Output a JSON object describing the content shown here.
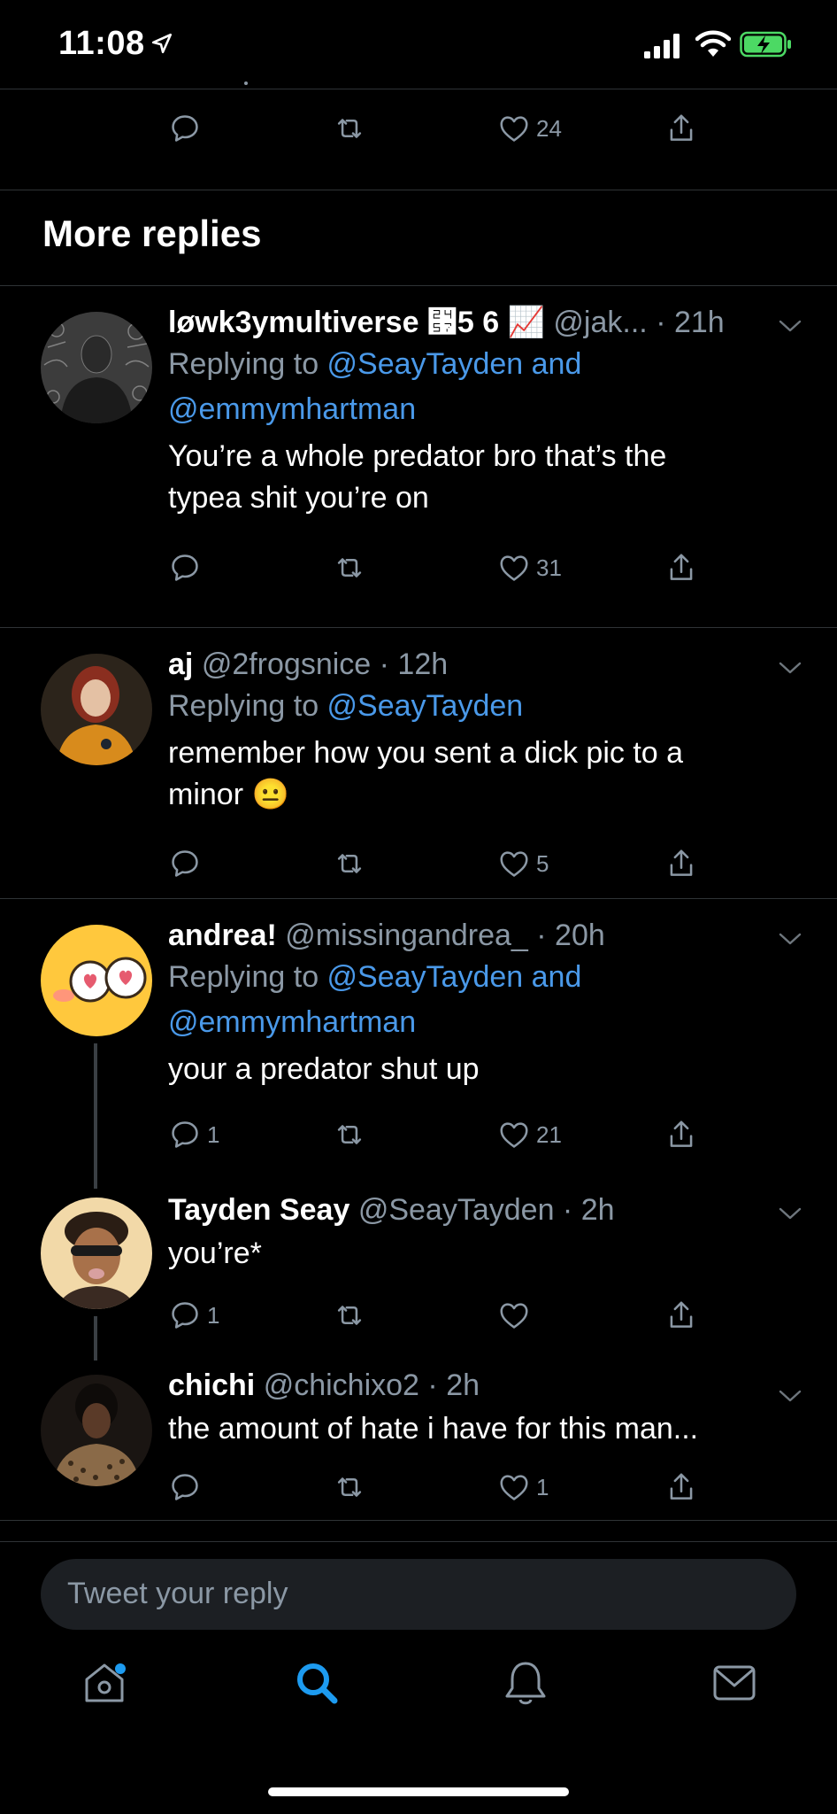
{
  "status": {
    "time": "11:08"
  },
  "section_title": "More replies",
  "top_actions": {
    "likes": "24"
  },
  "tweets": [
    {
      "name": "løwk3ymultiverse ⑗5 6 📈",
      "handle": "@jak...",
      "time": "21h",
      "replying_prefix": "Replying to ",
      "mentions": "@SeayTayden and",
      "mentions2": "@emmymhartman",
      "text1": "You’re a whole predator bro that’s the",
      "text2": "typea shit you’re on",
      "replies": "",
      "likes": "31"
    },
    {
      "name": "aj",
      "handle": "@2frogsnice",
      "time": "12h",
      "replying_prefix": "Replying to ",
      "mentions": "@SeayTayden",
      "text1": "remember how you sent a dick pic to a",
      "text2": "minor 😐",
      "replies": "",
      "likes": "5"
    },
    {
      "name": "andrea!",
      "handle": "@missingandrea_",
      "time": "20h",
      "replying_prefix": "Replying to ",
      "mentions": "@SeayTayden and",
      "mentions2": "@emmymhartman",
      "text1": "your a predator shut up",
      "replies": "1",
      "likes": "21"
    },
    {
      "name": "Tayden Seay",
      "handle": "@SeayTayden",
      "time": "2h",
      "text1": "you’re*",
      "replies": "1",
      "likes": ""
    },
    {
      "name": "chichi",
      "handle": "@chichixo2",
      "time": "2h",
      "text1": "the amount of hate i have for this man...",
      "replies": "",
      "likes": "1"
    }
  ],
  "compose": {
    "placeholder": "Tweet your reply"
  },
  "tabs": [
    "home-icon",
    "search-icon",
    "notifications-icon",
    "messages-icon"
  ],
  "colors": {
    "background": "#000000",
    "accent": "#1d9bf0",
    "mention": "#4a99e9",
    "muted": "#8b98a5"
  }
}
